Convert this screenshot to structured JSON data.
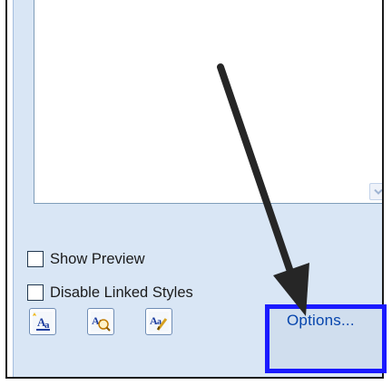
{
  "checkboxes": [
    {
      "label": "Show Preview",
      "checked": false
    },
    {
      "label": "Disable Linked Styles",
      "checked": false
    }
  ],
  "toolbar": {
    "new_style_icon": "new-style-icon",
    "style_inspector_icon": "style-inspector-icon",
    "manage_styles_icon": "manage-styles-icon"
  },
  "options_link": {
    "label": "Options..."
  },
  "annotation": {
    "highlight_color": "#1a1aff",
    "arrow_color": "#2b2b2b"
  }
}
